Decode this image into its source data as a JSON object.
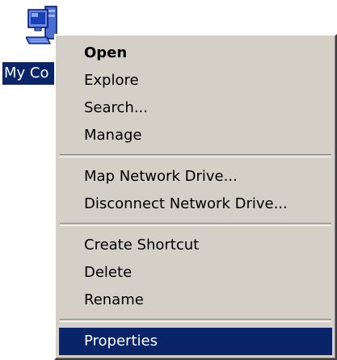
{
  "desktop_icon": {
    "label": "My Co",
    "icon": "my-computer-icon"
  },
  "context_menu": {
    "groups": [
      [
        {
          "label": "Open",
          "default": true
        },
        {
          "label": "Explore"
        },
        {
          "label": "Search..."
        },
        {
          "label": "Manage"
        }
      ],
      [
        {
          "label": "Map Network Drive..."
        },
        {
          "label": "Disconnect Network Drive..."
        }
      ],
      [
        {
          "label": "Create Shortcut"
        },
        {
          "label": "Delete"
        },
        {
          "label": "Rename"
        }
      ],
      [
        {
          "label": "Properties",
          "highlighted": true
        }
      ]
    ]
  },
  "colors": {
    "selection": "#0a246a",
    "menu_face": "#d4d0c8",
    "desktop": "#ffffff"
  }
}
